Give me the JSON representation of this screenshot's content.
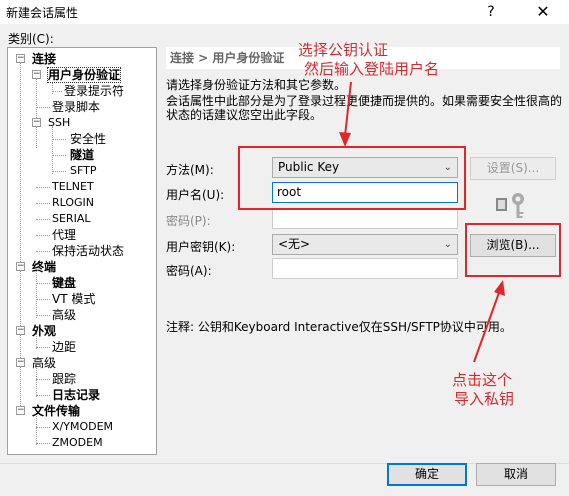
{
  "window": {
    "title": "新建会话属性",
    "help": "?",
    "close": "✕"
  },
  "tree": {
    "label": "类别(C):",
    "items": [
      {
        "label": "连接"
      },
      {
        "label": "用户身份验证"
      },
      {
        "label": "登录提示符"
      },
      {
        "label": "登录脚本"
      },
      {
        "label": "SSH"
      },
      {
        "label": "安全性"
      },
      {
        "label": "隧道"
      },
      {
        "label": "SFTP"
      },
      {
        "label": "TELNET"
      },
      {
        "label": "RLOGIN"
      },
      {
        "label": "SERIAL"
      },
      {
        "label": "代理"
      },
      {
        "label": "保持活动状态"
      },
      {
        "label": "终端"
      },
      {
        "label": "键盘"
      },
      {
        "label": "VT 模式"
      },
      {
        "label": "高级"
      },
      {
        "label": "外观"
      },
      {
        "label": "边距"
      },
      {
        "label": "高级"
      },
      {
        "label": "跟踪"
      },
      {
        "label": "日志记录"
      },
      {
        "label": "文件传输"
      },
      {
        "label": "X/YMODEM"
      },
      {
        "label": "ZMODEM"
      }
    ]
  },
  "panel": {
    "breadcrumb": "连接 > 用户身份验证",
    "desc1": "请选择身份验证方法和其它参数。",
    "desc2": "会话属性中此部分是为了登录过程更便捷而提供的。如果需要安全性很高的状态的话建议您空出此字段。",
    "method_label": "方法(M):",
    "method_value": "Public Key",
    "username_label": "用户名(U):",
    "username_value": "root",
    "password_label": "密码(P):",
    "userkey_label": "用户密钥(K):",
    "userkey_value": "<无>",
    "passphrase_label": "密码(A):",
    "settings_button": "设置(S)...",
    "browse_button": "浏览(B)...",
    "note": "注释: 公钥和Keyboard Interactive仅在SSH/SFTP协议中可用。"
  },
  "annotations": {
    "top_line1": "选择公钥认证",
    "top_line2": "然后输入登陆用户名",
    "bottom_line1": "点击这个",
    "bottom_line2": "导入私钥"
  },
  "footer": {
    "ok": "确定",
    "cancel": "取消"
  },
  "colors": {
    "annotation_red": "#e0262a",
    "focus_blue": "#0078d7"
  }
}
